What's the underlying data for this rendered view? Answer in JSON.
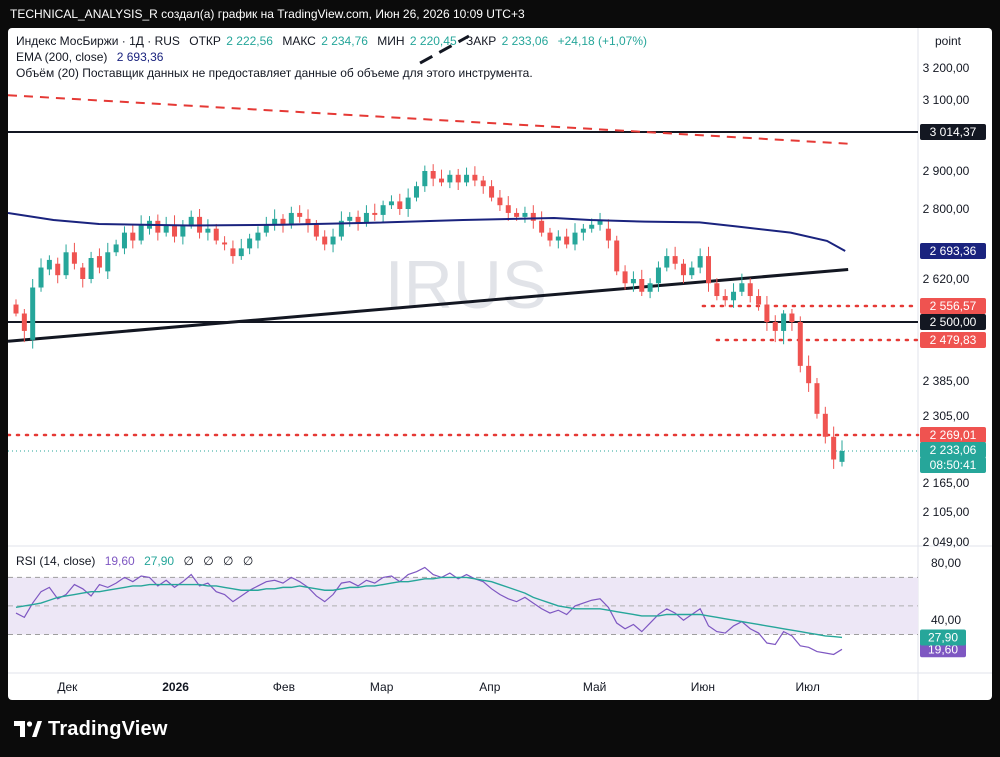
{
  "header": {
    "caption": "TECHNICAL_ANALYSIS_R создал(а) график на TradingView.com, Июн 26, 2026 10:09 UTC+3"
  },
  "legend": {
    "symbol": "Индекс МосБиржи · 1Д · RUS",
    "open_label": "ОТКР",
    "open_value": "2 222,56",
    "high_label": "МАКС",
    "high_value": "2 234,76",
    "low_label": "МИН",
    "low_value": "2 220,45",
    "close_label": "ЗАКР",
    "close_value": "2 233,06",
    "change": "+24,18 (+1,07%)",
    "ema_label": "EMA (200, close)",
    "ema_value": "2 693,36",
    "volume_note": "Объём (20)  Поставщик данных не предоставляет данные об объеме для этого инструмента.",
    "watermark": "IRUS",
    "scale_mode": "point"
  },
  "colors": {
    "up": "#26a69a",
    "down": "#ef5350",
    "ema": "#1a237e",
    "rsi": "#7e57c2",
    "rsi_ma": "#26a69a",
    "level_red": "#e53935",
    "price_box": "#26a69a"
  },
  "chart_data": [
    {
      "type": "candlestick",
      "title": "Индекс МосБиржи · 1Д · RUS",
      "ylim": [
        2049,
        3260
      ],
      "y_ticks": [
        "3 200,00",
        "3 100,00",
        "2 900,00",
        "2 800,00",
        "2 620,00",
        "2 385,00",
        "2 305,00",
        "2 165,00",
        "2 105,00",
        "2 049,00"
      ],
      "x_ticks": [
        "Дек",
        "2026",
        "Фев",
        "Мар",
        "Апр",
        "Май",
        "Июн",
        "Июл"
      ],
      "price_labels": [
        {
          "text": "3 014,37",
          "style": "black"
        },
        {
          "text": "2 693,36",
          "style": "navy"
        },
        {
          "text": "2 556,57",
          "style": "red"
        },
        {
          "text": "2 500,00",
          "style": "black"
        },
        {
          "text": "2 479,83",
          "style": "red"
        },
        {
          "text": "2 269,01",
          "style": "red"
        },
        {
          "text": "2 233,06",
          "style": "green"
        },
        {
          "text": "08:50:41",
          "style": "green"
        }
      ],
      "horizontal_levels": [
        3014.37,
        2500.0
      ],
      "dotted_levels": [
        {
          "from_date": "2026-06-01",
          "value": 2556.57
        },
        {
          "from_date": "2026-06-05",
          "value": 2479.83
        },
        {
          "from_date": "2025-11-14",
          "value": 2269.01
        }
      ],
      "trendlines": [
        {
          "style": "solid",
          "from": [
            "2025-11-14",
            2477
          ],
          "to": [
            "2026-06-30",
            2645
          ]
        },
        {
          "style": "dashed-red",
          "from": [
            "2025-11-14",
            3115
          ],
          "to": [
            "2026-06-30",
            2980
          ]
        },
        {
          "style": "dashed-black",
          "from": [
            "2026-03-12",
            3210
          ],
          "to": [
            "2026-03-26",
            3265
          ]
        }
      ],
      "ema_points": [
        [
          0,
          2790
        ],
        [
          0.05,
          2772
        ],
        [
          0.1,
          2762
        ],
        [
          0.2,
          2758
        ],
        [
          0.3,
          2760
        ],
        [
          0.4,
          2765
        ],
        [
          0.5,
          2772
        ],
        [
          0.6,
          2777
        ],
        [
          0.64,
          2772
        ],
        [
          0.7,
          2768
        ],
        [
          0.76,
          2766
        ],
        [
          0.8,
          2756
        ],
        [
          0.86,
          2740
        ],
        [
          0.9,
          2719
        ],
        [
          0.92,
          2693.36
        ]
      ],
      "candles": [
        [
          2560,
          2530
        ],
        [
          2530,
          2490
        ],
        [
          2480,
          2600
        ],
        [
          2600,
          2650
        ],
        [
          2645,
          2670
        ],
        [
          2660,
          2630
        ],
        [
          2630,
          2690
        ],
        [
          2690,
          2660
        ],
        [
          2650,
          2620
        ],
        [
          2620,
          2675
        ],
        [
          2680,
          2650
        ],
        [
          2640,
          2690
        ],
        [
          2690,
          2710
        ],
        [
          2700,
          2740
        ],
        [
          2740,
          2720
        ],
        [
          2720,
          2760
        ],
        [
          2750,
          2770
        ],
        [
          2770,
          2740
        ],
        [
          2740,
          2760
        ],
        [
          2760,
          2730
        ],
        [
          2730,
          2760
        ],
        [
          2760,
          2780
        ],
        [
          2780,
          2740
        ],
        [
          2740,
          2750
        ],
        [
          2750,
          2720
        ],
        [
          2715,
          2710
        ],
        [
          2700,
          2680
        ],
        [
          2680,
          2700
        ],
        [
          2700,
          2725
        ],
        [
          2720,
          2740
        ],
        [
          2740,
          2760
        ],
        [
          2760,
          2775
        ],
        [
          2775,
          2760
        ],
        [
          2760,
          2790
        ],
        [
          2790,
          2780
        ],
        [
          2775,
          2760
        ],
        [
          2760,
          2730
        ],
        [
          2730,
          2710
        ],
        [
          2710,
          2730
        ],
        [
          2730,
          2770
        ],
        [
          2770,
          2780
        ],
        [
          2780,
          2765
        ],
        [
          2765,
          2790
        ],
        [
          2790,
          2785
        ],
        [
          2785,
          2810
        ],
        [
          2810,
          2820
        ],
        [
          2820,
          2800
        ],
        [
          2800,
          2830
        ],
        [
          2830,
          2860
        ],
        [
          2860,
          2900
        ],
        [
          2900,
          2880
        ],
        [
          2880,
          2870
        ],
        [
          2870,
          2890
        ],
        [
          2890,
          2870
        ],
        [
          2870,
          2890
        ],
        [
          2890,
          2875
        ],
        [
          2875,
          2860
        ],
        [
          2860,
          2830
        ],
        [
          2830,
          2810
        ],
        [
          2810,
          2790
        ],
        [
          2790,
          2780
        ],
        [
          2780,
          2790
        ],
        [
          2790,
          2770
        ],
        [
          2770,
          2740
        ],
        [
          2740,
          2720
        ],
        [
          2720,
          2730
        ],
        [
          2730,
          2710
        ],
        [
          2710,
          2740
        ],
        [
          2740,
          2750
        ],
        [
          2750,
          2760
        ],
        [
          2760,
          2770
        ],
        [
          2750,
          2720
        ],
        [
          2720,
          2640
        ],
        [
          2640,
          2610
        ],
        [
          2610,
          2620
        ],
        [
          2620,
          2590
        ],
        [
          2590,
          2610
        ],
        [
          2610,
          2650
        ],
        [
          2650,
          2680
        ],
        [
          2680,
          2660
        ],
        [
          2660,
          2630
        ],
        [
          2630,
          2650
        ],
        [
          2650,
          2680
        ],
        [
          2680,
          2610
        ],
        [
          2610,
          2580
        ],
        [
          2580,
          2570
        ],
        [
          2570,
          2590
        ],
        [
          2590,
          2610
        ],
        [
          2610,
          2580
        ],
        [
          2580,
          2560
        ],
        [
          2560,
          2500
        ],
        [
          2500,
          2490
        ],
        [
          2490,
          2530
        ],
        [
          2530,
          2500
        ],
        [
          2500,
          2420
        ],
        [
          2420,
          2380
        ],
        [
          2380,
          2310
        ],
        [
          2310,
          2265
        ],
        [
          2265,
          2215
        ],
        [
          2210,
          2233.06
        ]
      ]
    },
    {
      "type": "line",
      "title": "RSI (14, close)",
      "legend_values": [
        "19,60",
        "27,90",
        "∅",
        "∅",
        "∅",
        "∅"
      ],
      "ylim": [
        10,
        85
      ],
      "y_ticks": [
        "80,00",
        "40,00"
      ],
      "bands": [
        70,
        30
      ],
      "series": [
        {
          "name": "RSI (14, close)",
          "value_label": "19,60",
          "values": [
            45,
            42,
            52,
            60,
            63,
            55,
            58,
            65,
            62,
            57,
            65,
            63,
            66,
            70,
            67,
            71,
            70,
            64,
            68,
            63,
            67,
            72,
            64,
            66,
            60,
            58,
            53,
            57,
            61,
            64,
            67,
            68,
            66,
            70,
            67,
            63,
            57,
            53,
            58,
            66,
            67,
            64,
            68,
            66,
            70,
            71,
            67,
            72,
            74,
            77,
            72,
            70,
            73,
            69,
            72,
            69,
            67,
            62,
            58,
            55,
            53,
            56,
            52,
            48,
            45,
            47,
            44,
            50,
            52,
            54,
            55,
            49,
            38,
            34,
            37,
            32,
            38,
            44,
            48,
            45,
            40,
            44,
            48,
            36,
            32,
            31,
            36,
            39,
            34,
            31,
            24,
            23,
            32,
            29,
            22,
            21,
            18,
            17,
            16,
            19.6
          ]
        },
        {
          "name": "RSI-based MA",
          "value_label": "27,90",
          "values": [
            49,
            50,
            51,
            52,
            54,
            56,
            57,
            58,
            59,
            60,
            60,
            61,
            62,
            63,
            64,
            64,
            65,
            65,
            65,
            65,
            65,
            65,
            65,
            64,
            64,
            63,
            62,
            61,
            61,
            61,
            62,
            62,
            63,
            63,
            64,
            63,
            62,
            61,
            61,
            62,
            63,
            63,
            64,
            64,
            65,
            66,
            67,
            67,
            68,
            69,
            69,
            70,
            70,
            70,
            70,
            69,
            68,
            67,
            65,
            63,
            61,
            59,
            56,
            54,
            52,
            50,
            49,
            48,
            48,
            48,
            48,
            47,
            46,
            45,
            44,
            43,
            43,
            43,
            44,
            44,
            44,
            44,
            44,
            43,
            42,
            41,
            40,
            39,
            38,
            37,
            36,
            35,
            34,
            33,
            32,
            31,
            30,
            29,
            28.5,
            27.9
          ]
        }
      ]
    }
  ]
}
